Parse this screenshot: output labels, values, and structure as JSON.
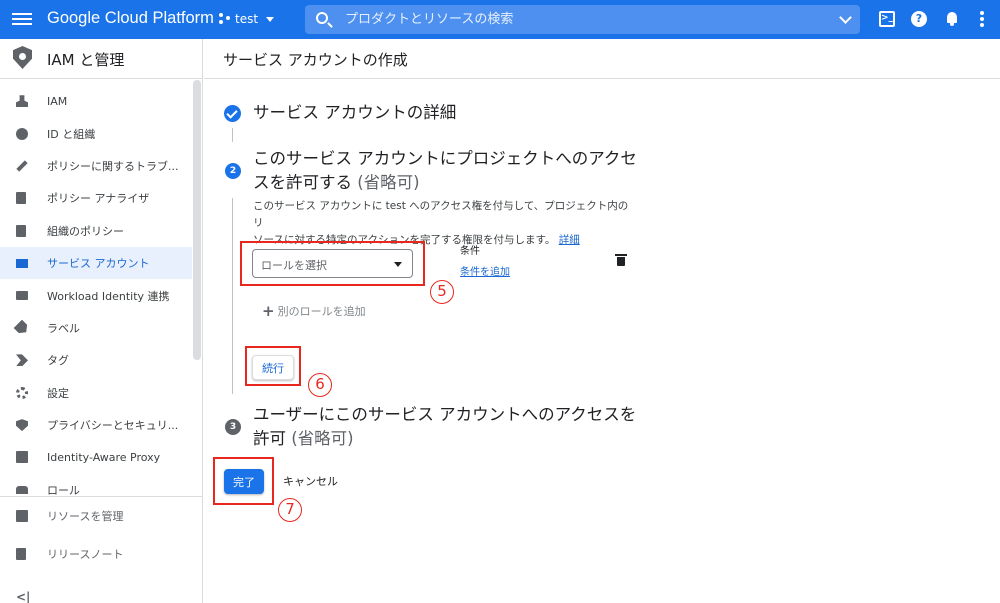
{
  "topbar": {
    "brand": "Google Cloud Platform",
    "project": "test",
    "search_placeholder": "プロダクトとリソースの検索",
    "help_glyph": "?",
    "terminal_glyph": ">_"
  },
  "sidebar": {
    "title": "IAM と管理",
    "items": [
      {
        "label": "IAM",
        "icon": "person-add-icon"
      },
      {
        "label": "ID と組織",
        "icon": "account-circle-icon"
      },
      {
        "label": "ポリシーに関するトラブ...",
        "icon": "wrench-icon"
      },
      {
        "label": "ポリシー アナライザ",
        "icon": "policy-analyzer-icon"
      },
      {
        "label": "組織のポリシー",
        "icon": "list-icon"
      },
      {
        "label": "サービス アカウント",
        "icon": "service-account-icon"
      },
      {
        "label": "Workload Identity 連携",
        "icon": "id-card-icon"
      },
      {
        "label": "ラベル",
        "icon": "label-icon"
      },
      {
        "label": "タグ",
        "icon": "tag-icon"
      },
      {
        "label": "設定",
        "icon": "gear-icon"
      },
      {
        "label": "プライバシーとセキュリ...",
        "icon": "shield-icon"
      },
      {
        "label": "Identity-Aware Proxy",
        "icon": "proxy-icon"
      },
      {
        "label": "ロール",
        "icon": "role-hat-icon"
      }
    ],
    "bottom": [
      {
        "label": "リソースを管理",
        "icon": "folder-gear-icon"
      },
      {
        "label": "リリースノート",
        "icon": "notes-icon"
      }
    ],
    "collapse_glyph": "<|"
  },
  "main": {
    "page_title": "サービス アカウントの作成",
    "step1": {
      "title": "サービス アカウントの詳細"
    },
    "step2": {
      "number": "2",
      "title_line1": "このサービス アカウントにプロジェクトへのアクセ",
      "title_line2": "スを許可する",
      "optional": "(省略可)",
      "desc_line1": "このサービス アカウントに test へのアクセス権を付与して、プロジェクト内のリ",
      "desc_line2": "ソースに対する特定のアクションを完了する権限を付与します。",
      "desc_link": "詳細",
      "role_placeholder": "ロールを選択",
      "condition_label": "条件",
      "add_condition": "条件を追加",
      "add_role": "別のロールを追加",
      "continue": "続行"
    },
    "step3": {
      "number": "3",
      "title_line1": "ユーザーにこのサービス アカウントへのアクセスを",
      "title_line2": "許可",
      "optional": "(省略可)"
    },
    "done": "完了",
    "cancel": "キャンセル"
  },
  "annotations": {
    "callout5": "5",
    "callout6": "6",
    "callout7": "7",
    "color": "#e8281e"
  },
  "colors": {
    "primary": "#1a73e8",
    "active_bg": "#e8f0fe"
  }
}
